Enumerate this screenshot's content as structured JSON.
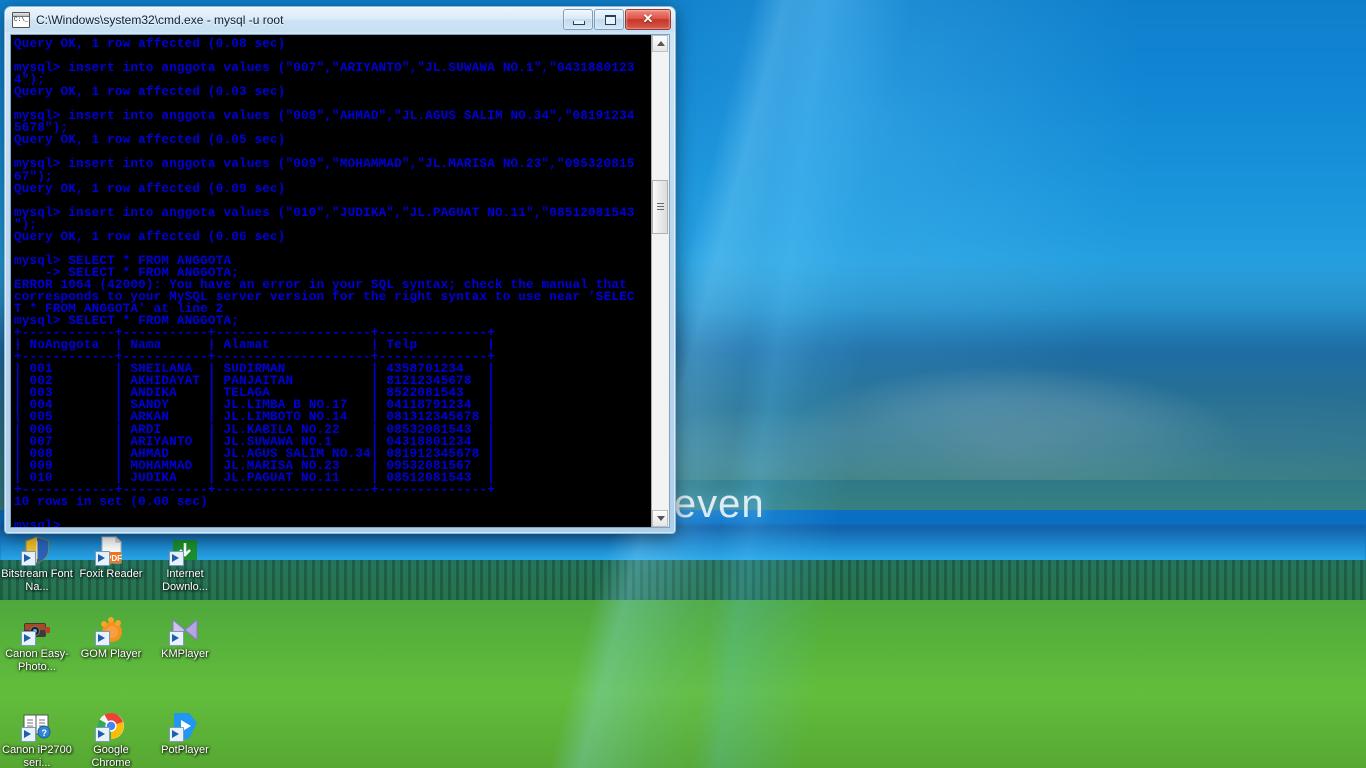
{
  "window": {
    "title": "C:\\Windows\\system32\\cmd.exe - mysql  -u root",
    "icon": "cmd-console-icon",
    "minimize_label": "Minimize",
    "maximize_label": "Maximize",
    "close_label": "✕",
    "frame_color": "#b0cfe9",
    "console_bg": "#000000",
    "console_fg": "#0000d8"
  },
  "console": {
    "lines": [
      "Query OK, 1 row affected (0.08 sec)",
      "",
      "mysql> insert into anggota values (\"007\",\"ARIYANTO\",\"JL.SUWAWA NO.1\",\"0431880123",
      "4\");",
      "Query OK, 1 row affected (0.03 sec)",
      "",
      "mysql> insert into anggota values (\"008\",\"AHMAD\",\"JL.AGUS SALIM NO.34\",\"08191234",
      "5678\");",
      "Query OK, 1 row affected (0.05 sec)",
      "",
      "mysql> insert into anggota values (\"009\",\"MOHAMMAD\",\"JL.MARISA NO.23\",\"095320815",
      "67\");",
      "Query OK, 1 row affected (0.09 sec)",
      "",
      "mysql> insert into anggota values (\"010\",\"JUDIKA\",\"JL.PAGUAT NO.11\",\"08512081543",
      "\");",
      "Query OK, 1 row affected (0.06 sec)",
      "",
      "mysql> SELECT * FROM ANGGOTA",
      "    -> SELECT * FROM ANGGOTA;",
      "ERROR 1064 (42000): You have an error in your SQL syntax; check the manual that",
      "corresponds to your MySQL server version for the right syntax to use near 'SELEC",
      "T * FROM ANGGOTA' at line 2",
      "mysql> SELECT * FROM ANGGOTA;",
      "+------------+-----------+--------------------+--------------+",
      "| NoAnggota  | Nama      | Alamat             | Telp         |",
      "+------------+-----------+--------------------+--------------+",
      "| 001        | SHEILANA  | SUDIRMAN           | 4358701234   |",
      "| 002        | AKHIDAYAT | PANJAITAN          | 81212345678  |",
      "| 003        | ANDIKA    | TELAGA             | 8522081543   |",
      "| 004        | SANDY     | JL.LIMBA B NO.17   | 04118791234  |",
      "| 005        | ARKAN     | JL.LIMBOTO NO.14   | 081312345678 |",
      "| 006        | ARDI      | JL.KABILA NO.22    | 08532081543  |",
      "| 007        | ARIYANTO  | JL.SUWAWA NO.1     | 04318801234  |",
      "| 008        | AHMAD     | JL.AGUS SALIM NO.34| 081912345678 |",
      "| 009        | MOHAMMAD  | JL.MARISA NO.23    | 09532081567  |",
      "| 010        | JUDIKA    | JL.PAGUAT NO.11    | 08512081543  |",
      "+------------+-----------+--------------------+--------------+",
      "10 rows in set (0.00 sec)",
      "",
      "mysql>"
    ],
    "result_table": {
      "headers": [
        "NoAnggota",
        "Nama",
        "Alamat",
        "Telp"
      ],
      "rows": [
        [
          "001",
          "SHEILANA",
          "SUDIRMAN",
          "4358701234"
        ],
        [
          "002",
          "AKHIDAYAT",
          "PANJAITAN",
          "81212345678"
        ],
        [
          "003",
          "ANDIKA",
          "TELAGA",
          "8522081543"
        ],
        [
          "004",
          "SANDY",
          "JL.LIMBA B NO.17",
          "04118791234"
        ],
        [
          "005",
          "ARKAN",
          "JL.LIMBOTO NO.14",
          "081312345678"
        ],
        [
          "006",
          "ARDI",
          "JL.KABILA NO.22",
          "08532081543"
        ],
        [
          "007",
          "ARIYANTO",
          "JL.SUWAWA NO.1",
          "04318801234"
        ],
        [
          "008",
          "AHMAD",
          "JL.AGUS SALIM NO.34",
          "081912345678"
        ],
        [
          "009",
          "MOHAMMAD",
          "JL.MARISA NO.23",
          "09532081567"
        ],
        [
          "010",
          "JUDIKA",
          "JL.PAGUAT NO.11",
          "08512081543"
        ]
      ],
      "row_count_text": "10 rows in set (0.00 sec)"
    },
    "error_code": "ERROR 1064 (42000)",
    "prompt": "mysql>"
  },
  "desktop": {
    "wallpaper_text": "ows Seven",
    "icons": [
      {
        "label": "Bitstream Font Na...",
        "art": "bitstream-shield"
      },
      {
        "label": "Foxit Reader",
        "art": "foxit-pdf"
      },
      {
        "label": "Internet Downlo...",
        "art": "idm-green"
      },
      {
        "label": "Canon Easy-Photo...",
        "art": "canon-camera"
      },
      {
        "label": "GOM Player",
        "art": "gom-player"
      },
      {
        "label": "KMPlayer",
        "art": "kmplayer"
      },
      {
        "label": "Canon iP2700 seri...",
        "art": "canon-manual"
      },
      {
        "label": "Google Chrome",
        "art": "chrome"
      },
      {
        "label": "PotPlayer",
        "art": "potplayer"
      }
    ]
  }
}
